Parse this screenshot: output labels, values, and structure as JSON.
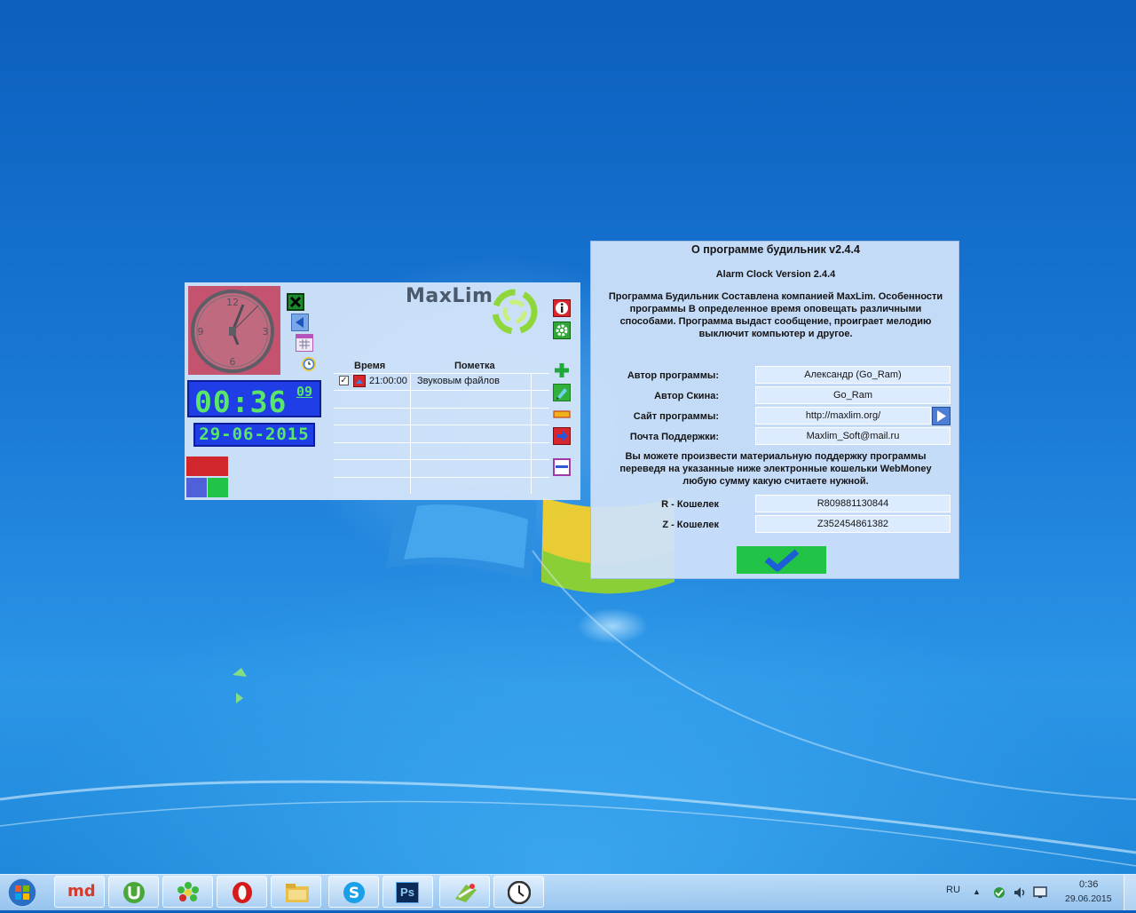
{
  "clock_window": {
    "brand": "MaxLim",
    "analog_numbers": {
      "n12": "12",
      "n3": "3",
      "n6": "6",
      "n9": "9"
    },
    "time_hm": "00:36",
    "time_seconds": "09",
    "date": "29-06-2015",
    "list": {
      "col_time": "Время",
      "col_note": "Пометка",
      "rows": [
        {
          "time": "21:00:00",
          "note": "Звуковым файлов",
          "checked": true
        }
      ]
    },
    "icons": {
      "left_toolbar": [
        "close-icon",
        "back-arrow-icon",
        "calendar-icon",
        "alarm-clock-icon"
      ],
      "right_toolbar": [
        "info-icon",
        "settings-gear-icon",
        "add-icon",
        "edit-icon",
        "remove-icon",
        "arrow-right-icon",
        "minimize-icon"
      ]
    },
    "colors": {
      "clock_face": "#c4536f",
      "digital_bg": "#1f3ee6",
      "digital_text": "#59e66a"
    }
  },
  "about_dialog": {
    "title": "О программе будильник v2.4.4",
    "version": "Alarm Clock Version 2.4.4",
    "description": "Программа Будильник Составлена компанией MaxLim. Особенности программы В определенное время оповещать различными способами. Программа выдаст сообщение, проиграет мелодию выключит компьютер и другое.",
    "fields": [
      {
        "label": "Автор программы:",
        "value": "Александр (Go_Ram)"
      },
      {
        "label": "Автор Скина:",
        "value": "Go_Ram"
      },
      {
        "label": "Сайт программы:",
        "value": "http://maxlim.org/"
      },
      {
        "label": "Почта Поддержки:",
        "value": "Maxlim_Soft@mail.ru"
      }
    ],
    "support_text": "Вы можете произвести материальную поддержку программы переведя на указанные ниже электронные кошельки WebMoney любую сумму какую считаете нужной.",
    "wallets": [
      {
        "label": "R - Кошелек",
        "value": "R809881130844"
      },
      {
        "label": "Z - Кошелек",
        "value": "Z352454861382"
      }
    ],
    "ok_icon": "checkmark-icon"
  },
  "taskbar": {
    "apps": [
      "start-orb-icon",
      "mediaget-icon",
      "utorrent-icon",
      "icq-icon",
      "opera-icon",
      "file-explorer-icon",
      "skype-icon",
      "photoshop-icon",
      "map-tool-icon",
      "alarm-clock-app-icon"
    ],
    "mediaget_label": "md",
    "photoshop_label": "Ps",
    "lang": "RU",
    "time": "0:36",
    "date": "29.06.2015"
  }
}
